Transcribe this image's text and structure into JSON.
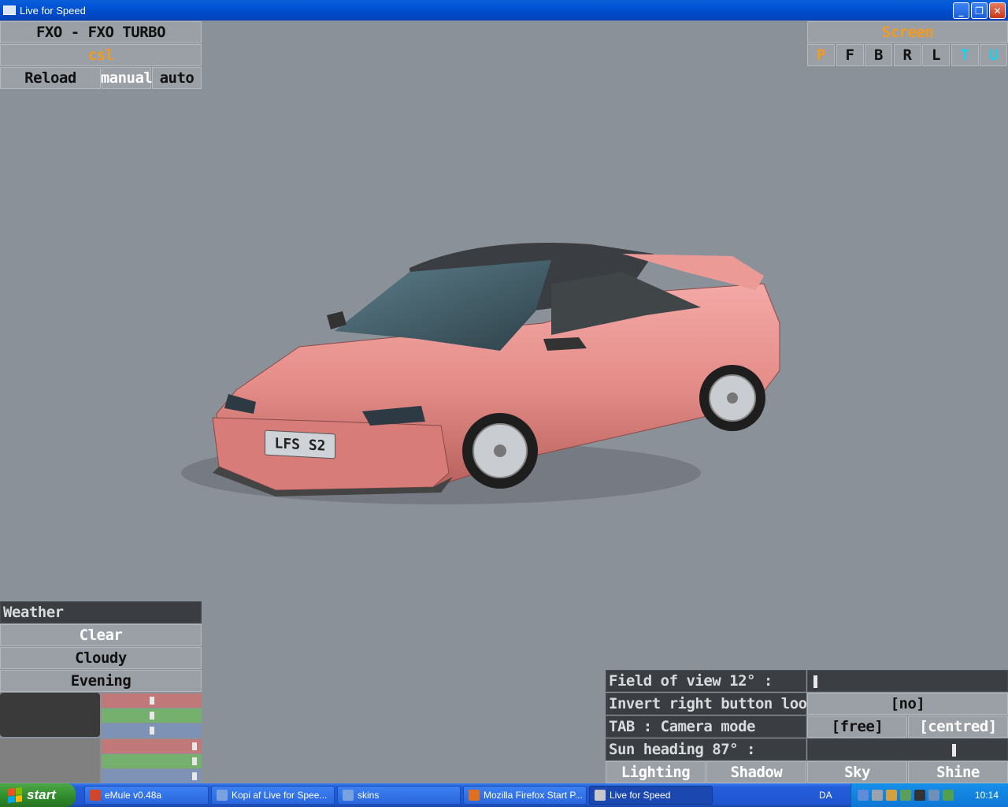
{
  "window": {
    "title": "Live for Speed"
  },
  "car_panel": {
    "car_name": "FXO - FXO TURBO",
    "skin": "csl",
    "reload": "Reload",
    "manual": "manual",
    "auto": "auto"
  },
  "screen_panel": {
    "title": "Screen",
    "buttons": [
      "P",
      "F",
      "B",
      "R",
      "L",
      "T",
      "U"
    ]
  },
  "car": {
    "plate": "LFS S2",
    "body_color": "#e8918c",
    "roof_color": "#3a3d42"
  },
  "weather": {
    "header": "Weather",
    "options": [
      "Clear",
      "Cloudy",
      "Evening"
    ],
    "swatch1": "#3a3a3a",
    "swatch2": "#808080",
    "sliders1": [
      {
        "color": "#c07878",
        "value": 0.5
      },
      {
        "color": "#76b06e",
        "value": 0.5
      },
      {
        "color": "#7d92b4",
        "value": 0.5
      }
    ],
    "sliders2": [
      {
        "color": "#c07878",
        "value": 0.95
      },
      {
        "color": "#76b06e",
        "value": 0.95
      },
      {
        "color": "#7d92b4",
        "value": 0.95
      }
    ]
  },
  "view_options": {
    "fov_label": "Field of view 12° :",
    "fov_value": 0.02,
    "invert_label": "Invert right button look :",
    "invert_value": "[no]",
    "tab_label": "TAB : Camera mode",
    "free": "[free]",
    "centred": "[centred]",
    "sun_label": "Sun heading 87° :",
    "sun_value": 0.74,
    "tabs": [
      "Lighting",
      "Shadow",
      "Sky",
      "Shine"
    ]
  },
  "taskbar": {
    "start": "start",
    "items": [
      {
        "label": "eMule v0.48a",
        "icon_color": "#d0462a"
      },
      {
        "label": "Kopi af Live for Spee...",
        "icon_color": "#7aa2e0"
      },
      {
        "label": "skins",
        "icon_color": "#7aa2e0"
      },
      {
        "label": "Mozilla Firefox Start P...",
        "icon_color": "#e07020"
      },
      {
        "label": "Live for Speed",
        "icon_color": "#c8c8c8"
      }
    ],
    "language": "DA",
    "clock": "10:14"
  }
}
